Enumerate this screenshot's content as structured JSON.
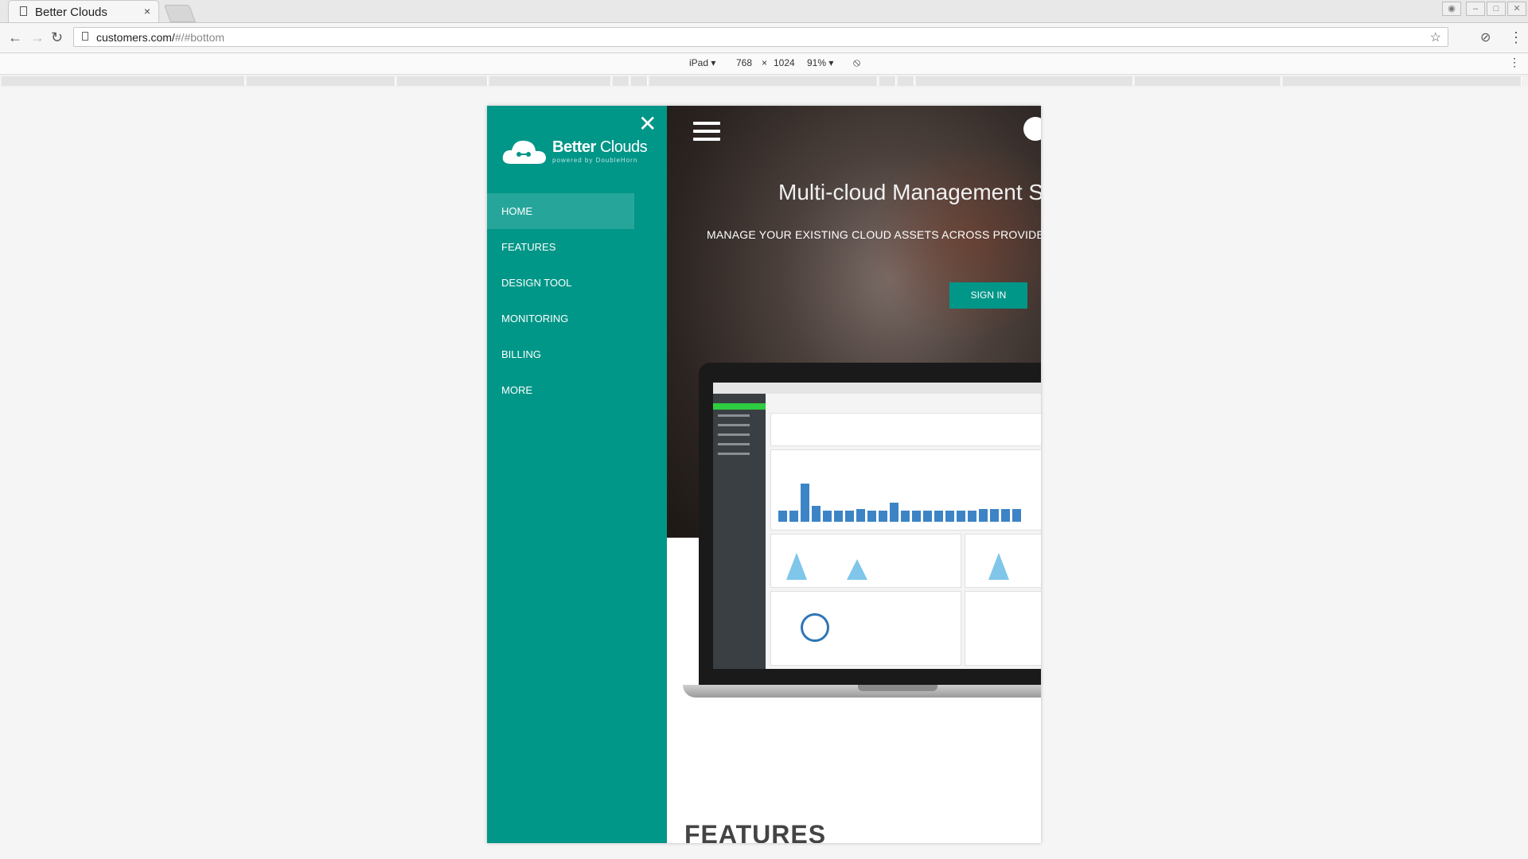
{
  "browser": {
    "tab_title": "Better Clouds",
    "tab_close": "×",
    "url_main": "customers.com/",
    "url_hash": "#/#bottom",
    "back_glyph": "←",
    "forward_glyph": "→",
    "reload_glyph": "↻",
    "star_glyph": "☆",
    "menu_glyph": "⋮"
  },
  "devtools": {
    "device": "iPad ▾",
    "width": "768",
    "times": "×",
    "height": "1024",
    "zoom": "91% ▾"
  },
  "sidebar": {
    "close_glyph": "✕",
    "brand_bold": "Better",
    "brand_light": "Clouds",
    "powered": "powered by DoubleHorn",
    "items": [
      {
        "label": "HOME"
      },
      {
        "label": "FEATURES"
      },
      {
        "label": "DESIGN TOOL"
      },
      {
        "label": "MONITORING"
      },
      {
        "label": "BILLING"
      },
      {
        "label": "MORE"
      }
    ]
  },
  "hero": {
    "headline": "Multi-cloud Management Sim",
    "subline": "MANAGE YOUR EXISTING CLOUD ASSETS ACROSS PROVIDERS W",
    "signin_label": "SIGN IN"
  },
  "section": {
    "features_heading": "FEATURES"
  },
  "colors": {
    "accent": "#009688",
    "accent_active": "#26a69a"
  }
}
